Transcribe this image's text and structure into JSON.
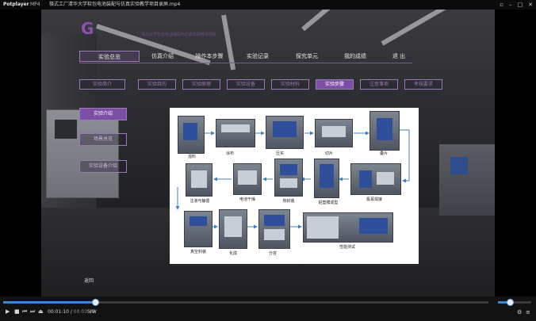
{
  "player": {
    "app_name": "Potplayer",
    "mode": "MP4",
    "filename": "筷式工厂清华大学软包电池装配与仿真实验教学项目录屏.mp4",
    "window_buttons": [
      "▫",
      "–",
      "□",
      "✕"
    ]
  },
  "lab": {
    "logo_text": "G",
    "logo_sub": "清华大学软包电池装配与仿真实验教学项目",
    "top_nav": [
      "实验总览",
      "仿真介绍",
      "操作本步骤",
      "实验记录",
      "探究单元",
      "我的成绩",
      "退 出"
    ],
    "top_nav_active": 0,
    "sub_tabs": [
      "实验简介",
      "实验目的",
      "实验原理",
      "实验设备",
      "实验材料",
      "实验步骤",
      "注意事项",
      "考核要求"
    ],
    "sub_tab_active": 5,
    "side_buttons": [
      "实验介绍",
      "场景总览",
      "实验设备介绍"
    ],
    "side_button_active": 0,
    "return_label": "返回"
  },
  "diagram": {
    "steps": [
      {
        "label": "混料"
      },
      {
        "label": "涂布"
      },
      {
        "label": "压实"
      },
      {
        "label": "切片"
      },
      {
        "label": "叠片"
      },
      {
        "label": "极耳焊接"
      },
      {
        "label": "铝塑膜成型"
      },
      {
        "label": "热封装"
      },
      {
        "label": "电池干燥"
      },
      {
        "label": "注液与静置"
      },
      {
        "label": "真空封装"
      },
      {
        "label": "化成"
      },
      {
        "label": "分容"
      },
      {
        "label": "性能测试"
      }
    ]
  },
  "controls": {
    "current_time": "00:01:10",
    "duration": "00:03:40",
    "sw_label": "S/W",
    "progress": 0.19,
    "volume": 0.35,
    "icons": [
      "play-icon",
      "stop-icon",
      "prev-icon",
      "next-icon",
      "eject-icon",
      "settings-icon",
      "menu-icon"
    ]
  }
}
